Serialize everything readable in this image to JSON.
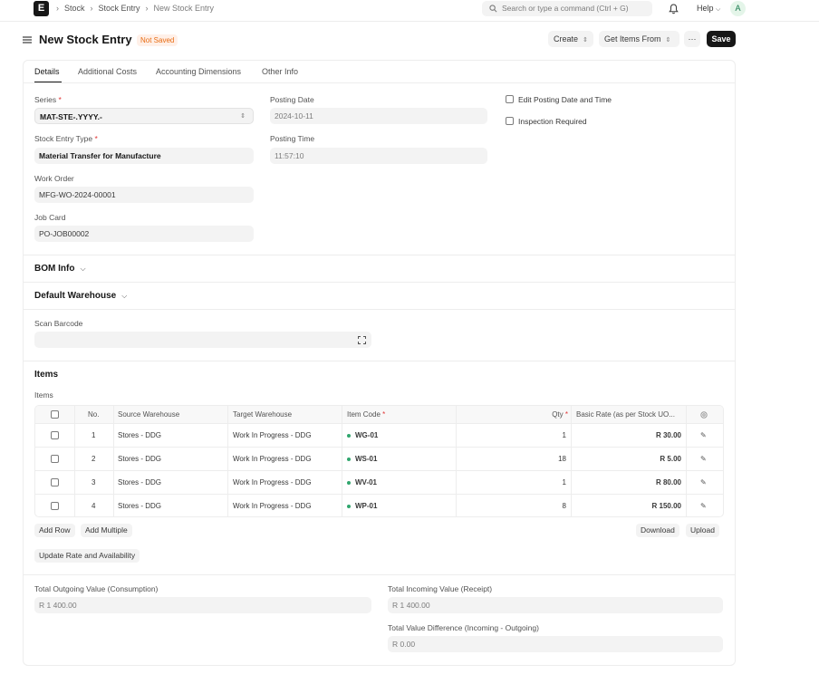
{
  "navbar": {
    "logo_letter": "E",
    "breadcrumbs": [
      "Stock",
      "Stock Entry",
      "New Stock Entry"
    ],
    "search_placeholder": "Search or type a command (Ctrl + G)",
    "help_label": "Help",
    "avatar_letter": "A"
  },
  "page": {
    "title": "New Stock Entry",
    "status": "Not Saved",
    "create_label": "Create",
    "get_items_label": "Get Items From",
    "more_label": "···",
    "save_label": "Save"
  },
  "tabs": [
    "Details",
    "Additional Costs",
    "Accounting Dimensions",
    "Other Info"
  ],
  "details": {
    "series_label": "Series",
    "series_value": "MAT-STE-.YYYY.-",
    "stock_entry_type_label": "Stock Entry Type",
    "stock_entry_type_value": "Material Transfer for Manufacture",
    "work_order_label": "Work Order",
    "work_order_value": "MFG-WO-2024-00001",
    "job_card_label": "Job Card",
    "job_card_value": "PO-JOB00002",
    "posting_date_label": "Posting Date",
    "posting_date_value": "2024-10-11",
    "posting_time_label": "Posting Time",
    "posting_time_value": "11:57:10",
    "edit_posting_label": "Edit Posting Date and Time",
    "inspection_label": "Inspection Required"
  },
  "sections": {
    "bom_info": "BOM Info",
    "default_warehouse": "Default Warehouse",
    "scan_barcode_label": "Scan Barcode",
    "items_title": "Items",
    "items_label": "Items"
  },
  "items_table": {
    "headers": [
      "No.",
      "Source Warehouse",
      "Target Warehouse",
      "Item Code",
      "Qty",
      "Basic Rate (as per Stock UO..."
    ],
    "rows": [
      {
        "no": "1",
        "source": "Stores - DDG",
        "target": "Work In Progress - DDG",
        "item_code": "WG-01",
        "qty": "1",
        "rate": "R 30.00"
      },
      {
        "no": "2",
        "source": "Stores - DDG",
        "target": "Work In Progress - DDG",
        "item_code": "WS-01",
        "qty": "18",
        "rate": "R 5.00"
      },
      {
        "no": "3",
        "source": "Stores - DDG",
        "target": "Work In Progress - DDG",
        "item_code": "WV-01",
        "qty": "1",
        "rate": "R 80.00"
      },
      {
        "no": "4",
        "source": "Stores - DDG",
        "target": "Work In Progress - DDG",
        "item_code": "WP-01",
        "qty": "8",
        "rate": "R 150.00"
      }
    ],
    "add_row_label": "Add Row",
    "add_multiple_label": "Add Multiple",
    "download_label": "Download",
    "upload_label": "Upload",
    "update_rate_label": "Update Rate and Availability"
  },
  "totals": {
    "outgoing_label": "Total Outgoing Value (Consumption)",
    "outgoing_value": "R 1 400.00",
    "incoming_label": "Total Incoming Value (Receipt)",
    "incoming_value": "R 1 400.00",
    "difference_label": "Total Value Difference (Incoming - Outgoing)",
    "difference_value": "R 0.00"
  },
  "colors": {
    "primary_button": "#171717",
    "status_orange": "#e86c13",
    "required_red": "#e03636",
    "item_dot_green": "#30a66d"
  }
}
